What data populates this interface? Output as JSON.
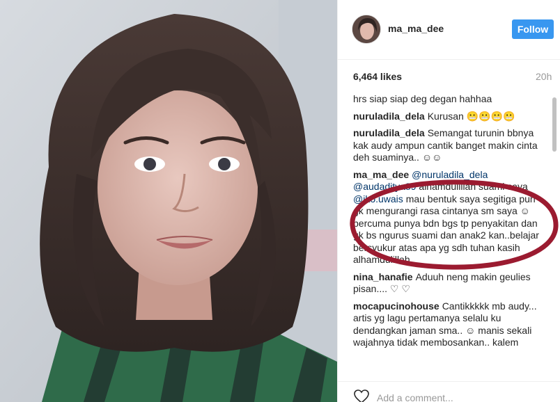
{
  "post": {
    "username": "ma_ma_dee",
    "follow_label": "Follow",
    "likes": "6,464 likes",
    "time": "20h",
    "caption": "hrs siap siap deg degan hahhaa"
  },
  "comments": [
    {
      "user": "nuruladila_dela",
      "text": "Kurusan 😬😬😬😬"
    },
    {
      "user": "nuruladila_dela",
      "text": "Semangat turunin bbnya kak audy ampun cantik banget makin cinta deh suaminya.. ☺☺"
    },
    {
      "user": "ma_ma_dee",
      "mentions": [
        "@nuruladila_dela",
        "@audaditya89"
      ],
      "text_a": "alhamdulillah suami saya",
      "mention_b": "@iko.uwais",
      "text_b": "mau bentuk saya segitiga pun gk mengurangi rasa cintanya sm saya ☺ percuma punya bdn bgs tp penyakitan dan gk bs ngurus suami dan anak2 kan..belajar bersyukur atas apa yg sdh tuhan kasih alhamdulillah"
    },
    {
      "user": "nina_hanafie",
      "text": "Aduuh neng makin geulies pisan.... ♡ ♡"
    },
    {
      "user": "mocapucinohouse",
      "text": "Cantikkkkk mb audy... artis yg lagu pertamanya selalu ku dendangkan jaman sma.. ☺ manis sekali wajahnya tidak membosankan.. kalem"
    }
  ],
  "footer": {
    "add_comment_placeholder": "Add a comment..."
  },
  "icons": {
    "like": "heart-icon"
  },
  "colors": {
    "follow": "#3897f0",
    "highlight_circle": "#9b1b30"
  }
}
